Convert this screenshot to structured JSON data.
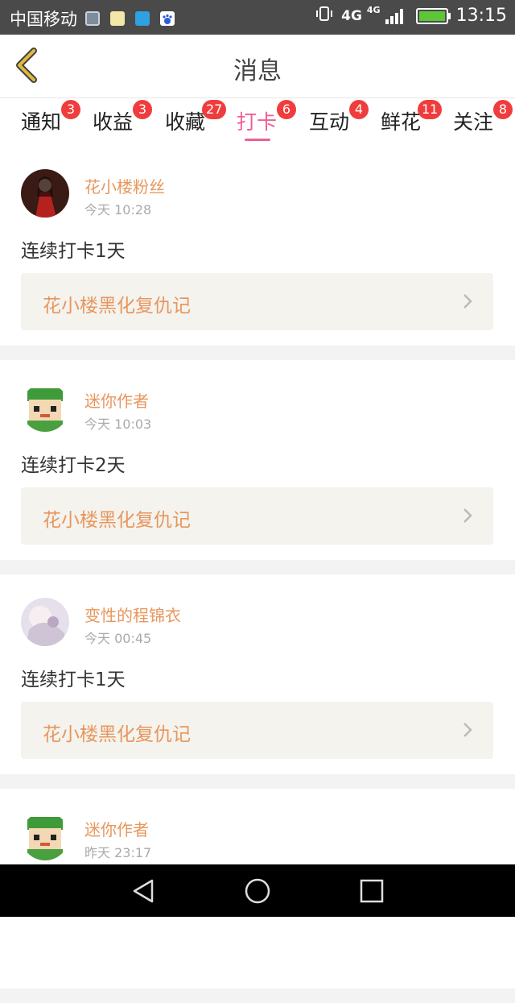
{
  "status_bar": {
    "carrier": "中国移动",
    "network": "4G",
    "network_small": "4G",
    "time": "13:15",
    "notification_icons": [
      "gallery-icon",
      "chat-bubble-icon",
      "message-icon",
      "baidu-paw-icon"
    ],
    "colors": {
      "background": "#4a4a4a",
      "battery": "#5ec639"
    }
  },
  "header": {
    "title": "消息",
    "back_icon": "chevron-left-icon",
    "back_color": "#e2b93b"
  },
  "tabs": [
    {
      "label": "通知",
      "badge": "3",
      "active": false
    },
    {
      "label": "收益",
      "badge": "3",
      "active": false
    },
    {
      "label": "收藏",
      "badge": "27",
      "active": false
    },
    {
      "label": "打卡",
      "badge": "6",
      "active": true
    },
    {
      "label": "互动",
      "badge": "4",
      "active": false
    },
    {
      "label": "鲜花",
      "badge": "11",
      "active": false
    },
    {
      "label": "关注",
      "badge": "8",
      "active": false
    }
  ],
  "feed": [
    {
      "user": "花小楼粉丝",
      "time": "今天 10:28",
      "text": "连续打卡1天",
      "book": "花小楼黑化复仇记",
      "avatar": "red-dress-figure"
    },
    {
      "user": "迷你作者",
      "time": "今天 10:03",
      "text": "连续打卡2天",
      "book": "花小楼黑化复仇记",
      "avatar": "green-block-character"
    },
    {
      "user": "变性的程锦衣",
      "time": "今天 00:45",
      "text": "连续打卡1天",
      "book": "花小楼黑化复仇记",
      "avatar": "pale-anime-figure"
    },
    {
      "user": "迷你作者",
      "time": "昨天 23:17",
      "text": "",
      "book": "",
      "avatar": "green-block-character"
    }
  ],
  "nav_bar": {
    "icons": [
      "back-triangle-icon",
      "home-circle-icon",
      "recents-square-icon"
    ]
  },
  "colors": {
    "accent": "#ee5f97",
    "username": "#e8965c",
    "badge": "#f03c3c",
    "book_bg": "#f4f3ee"
  }
}
